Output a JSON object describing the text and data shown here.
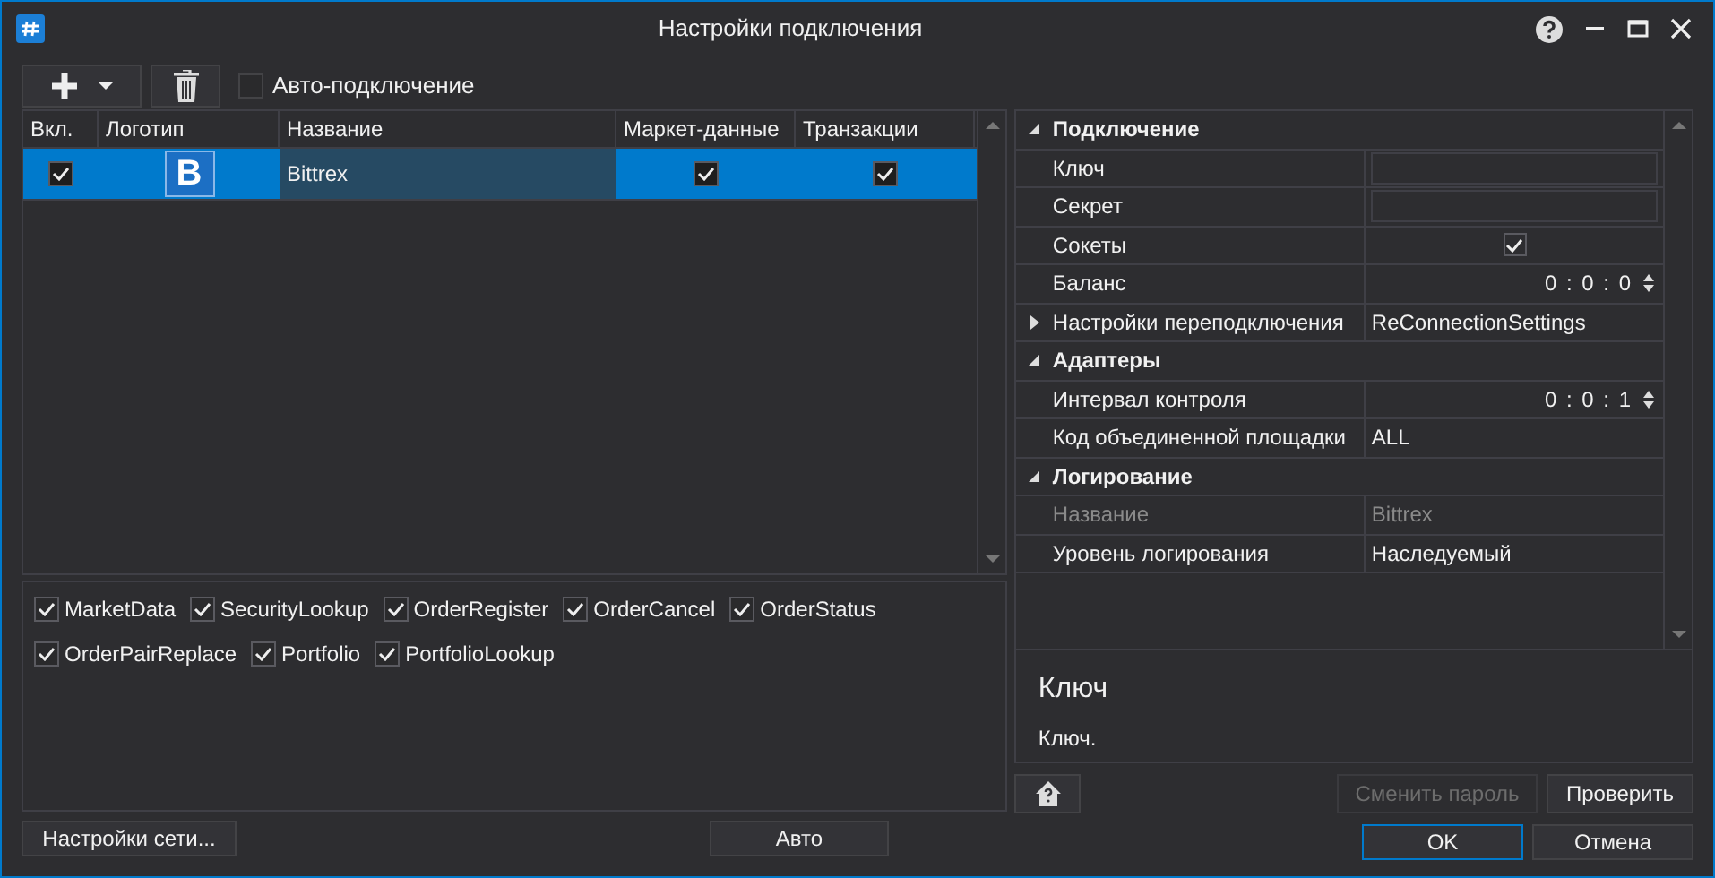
{
  "window": {
    "title": "Настройки подключения"
  },
  "toolbar": {
    "auto_connect": {
      "label": "Авто-подключение",
      "checked": false
    }
  },
  "grid": {
    "columns": [
      "Вкл.",
      "Логотип",
      "Название",
      "Маркет-данные",
      "Транзакции"
    ],
    "rows": [
      {
        "enabled": true,
        "logo": "B",
        "name": "Bittrex",
        "market_data": true,
        "transactions": true,
        "selected": true
      }
    ]
  },
  "adapters": [
    {
      "label": "MarketData",
      "checked": true
    },
    {
      "label": "SecurityLookup",
      "checked": true
    },
    {
      "label": "OrderRegister",
      "checked": true
    },
    {
      "label": "OrderCancel",
      "checked": true
    },
    {
      "label": "OrderStatus",
      "checked": true
    },
    {
      "label": "OrderPairReplace",
      "checked": true
    },
    {
      "label": "Portfolio",
      "checked": true
    },
    {
      "label": "PortfolioLookup",
      "checked": true
    }
  ],
  "properties": [
    {
      "category": "Подключение",
      "expanded": true,
      "items": [
        {
          "kind": "field",
          "name": "Ключ",
          "disabled": false
        },
        {
          "kind": "field",
          "name": "Секрет",
          "disabled": false
        },
        {
          "kind": "check",
          "name": "Сокеты",
          "checked": true,
          "disabled": false
        },
        {
          "kind": "time",
          "name": "Баланс",
          "value": "0 : 0 : 0",
          "disabled": false
        },
        {
          "kind": "group",
          "name": "Настройки переподключения",
          "value": "ReConnectionSettings",
          "expanded": false,
          "disabled": false
        }
      ]
    },
    {
      "category": "Адаптеры",
      "expanded": true,
      "items": [
        {
          "kind": "time",
          "name": "Интервал контроля",
          "value": "0 : 0 : 1",
          "disabled": false
        },
        {
          "kind": "text",
          "name": "Код объединенной площадки",
          "value": "ALL",
          "disabled": false
        }
      ]
    },
    {
      "category": "Логирование",
      "expanded": true,
      "items": [
        {
          "kind": "text",
          "name": "Название",
          "value": "Bittrex",
          "disabled": true
        },
        {
          "kind": "text",
          "name": "Уровень логирования",
          "value": "Наследуемый",
          "disabled": false
        }
      ]
    }
  ],
  "description": {
    "title": "Ключ",
    "text": "Ключ."
  },
  "buttons": {
    "change_password": {
      "label": "Сменить пароль",
      "disabled": true
    },
    "check": {
      "label": "Проверить",
      "disabled": false
    },
    "network": {
      "label": "Настройки сети..."
    },
    "auto": {
      "label": "Авто"
    },
    "ok": {
      "label": "OK"
    },
    "cancel": {
      "label": "Отмена"
    }
  }
}
